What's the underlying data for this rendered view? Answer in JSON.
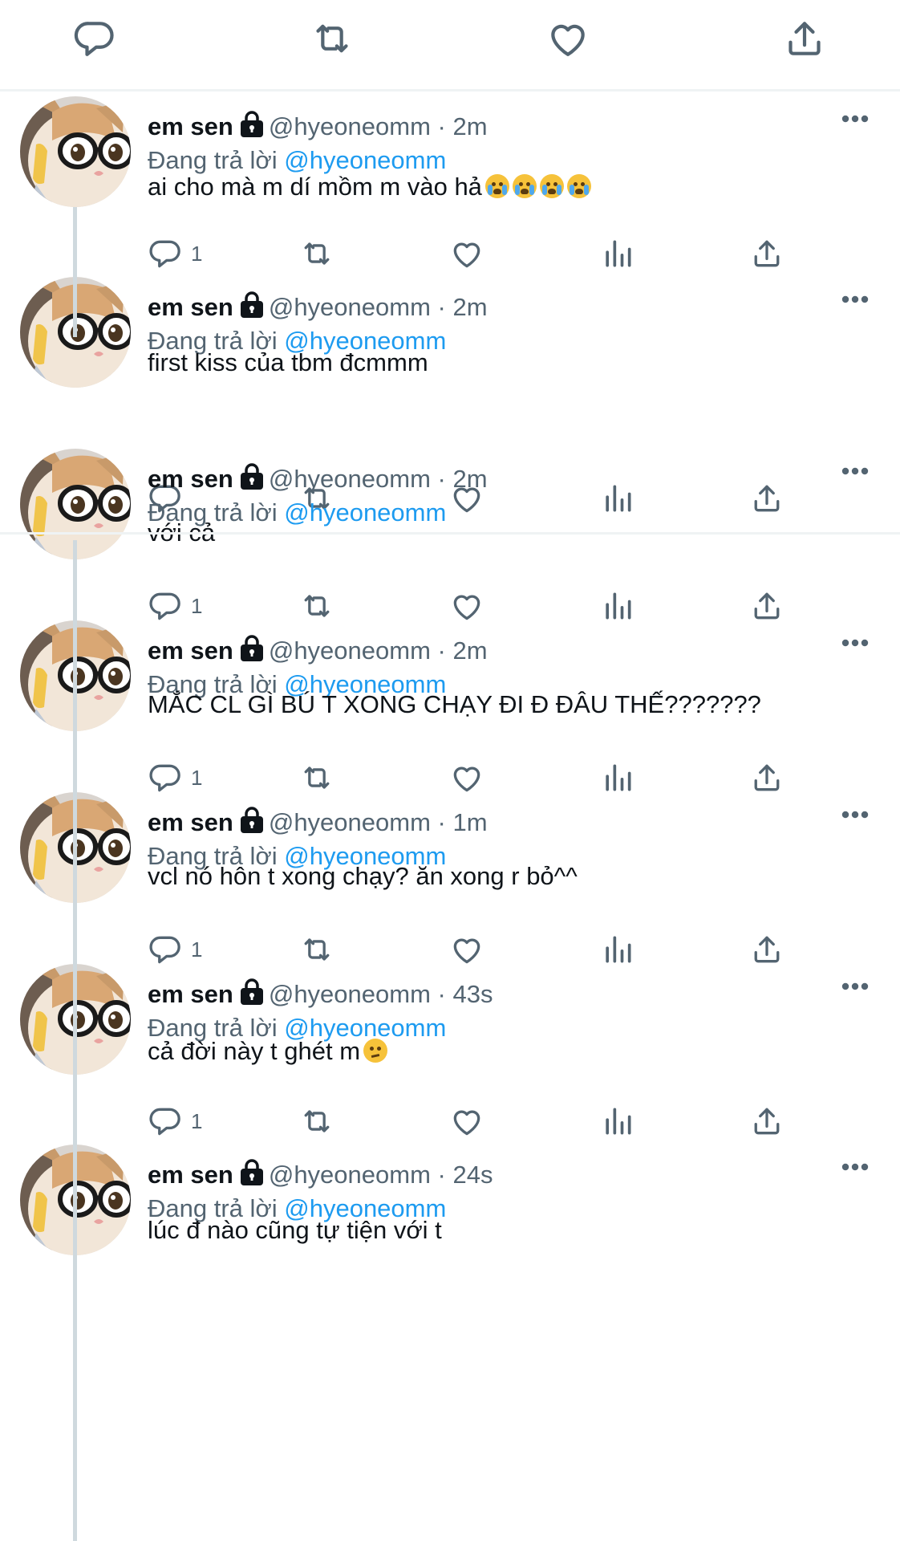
{
  "top_actions": {
    "icons": [
      "reply-icon",
      "retweet-icon",
      "like-icon",
      "share-icon"
    ]
  },
  "tweets": [
    {
      "display_name": "em sen",
      "handle": "@hyeoneomm",
      "separator": "·",
      "time": "2m",
      "replying_prefix": "Đang trả lời",
      "replying_to": "@hyeoneomm",
      "text": "ai cho mà m dí mồm m vào hả",
      "emojis": [
        "loudly-crying-face",
        "loudly-crying-face",
        "loudly-crying-face",
        "loudly-crying-face"
      ],
      "reply_count": "1"
    },
    {
      "display_name": "em sen",
      "handle": "@hyeoneomm",
      "separator": "·",
      "time": "2m",
      "replying_prefix": "Đang trả lời",
      "replying_to": "@hyeoneomm",
      "text": "first kiss của tbm đcmmm",
      "reply_count": ""
    },
    {
      "display_name": "em sen",
      "handle": "@hyeoneomm",
      "separator": "·",
      "time": "2m",
      "replying_prefix": "Đang trả lời",
      "replying_to": "@hyeoneomm",
      "text": "với cả",
      "reply_count": "1"
    },
    {
      "display_name": "em sen",
      "handle": "@hyeoneomm",
      "separator": "·",
      "time": "2m",
      "replying_prefix": "Đang trả lời",
      "replying_to": "@hyeoneomm",
      "text": "MẮC CL GÌ BÚ T XONG CHẠY ĐI Đ ĐÂU THẾ???????",
      "reply_count": "1"
    },
    {
      "display_name": "em sen",
      "handle": "@hyeoneomm",
      "separator": "·",
      "time": "1m",
      "replying_prefix": "Đang trả lời",
      "replying_to": "@hyeoneomm",
      "text": "vcl nó hôn t xong chạy? ăn xong r bỏ^^",
      "reply_count": "1"
    },
    {
      "display_name": "em sen",
      "handle": "@hyeoneomm",
      "separator": "·",
      "time": "43s",
      "replying_prefix": "Đang trả lời",
      "replying_to": "@hyeoneomm",
      "text": "cả đời này t ghét m",
      "emojis": [
        "confused-face"
      ],
      "reply_count": "1"
    },
    {
      "display_name": "em sen",
      "handle": "@hyeoneomm",
      "separator": "·",
      "time": "24s",
      "replying_prefix": "Đang trả lời",
      "replying_to": "@hyeoneomm",
      "text": "lúc đ nào cũng tự tiện với t",
      "reply_count": ""
    }
  ],
  "colors": {
    "accent": "#1d9bf0",
    "text_primary": "#0f1419",
    "text_secondary": "#536471",
    "thread_line": "#cfd9de",
    "divider": "#eff3f4"
  }
}
